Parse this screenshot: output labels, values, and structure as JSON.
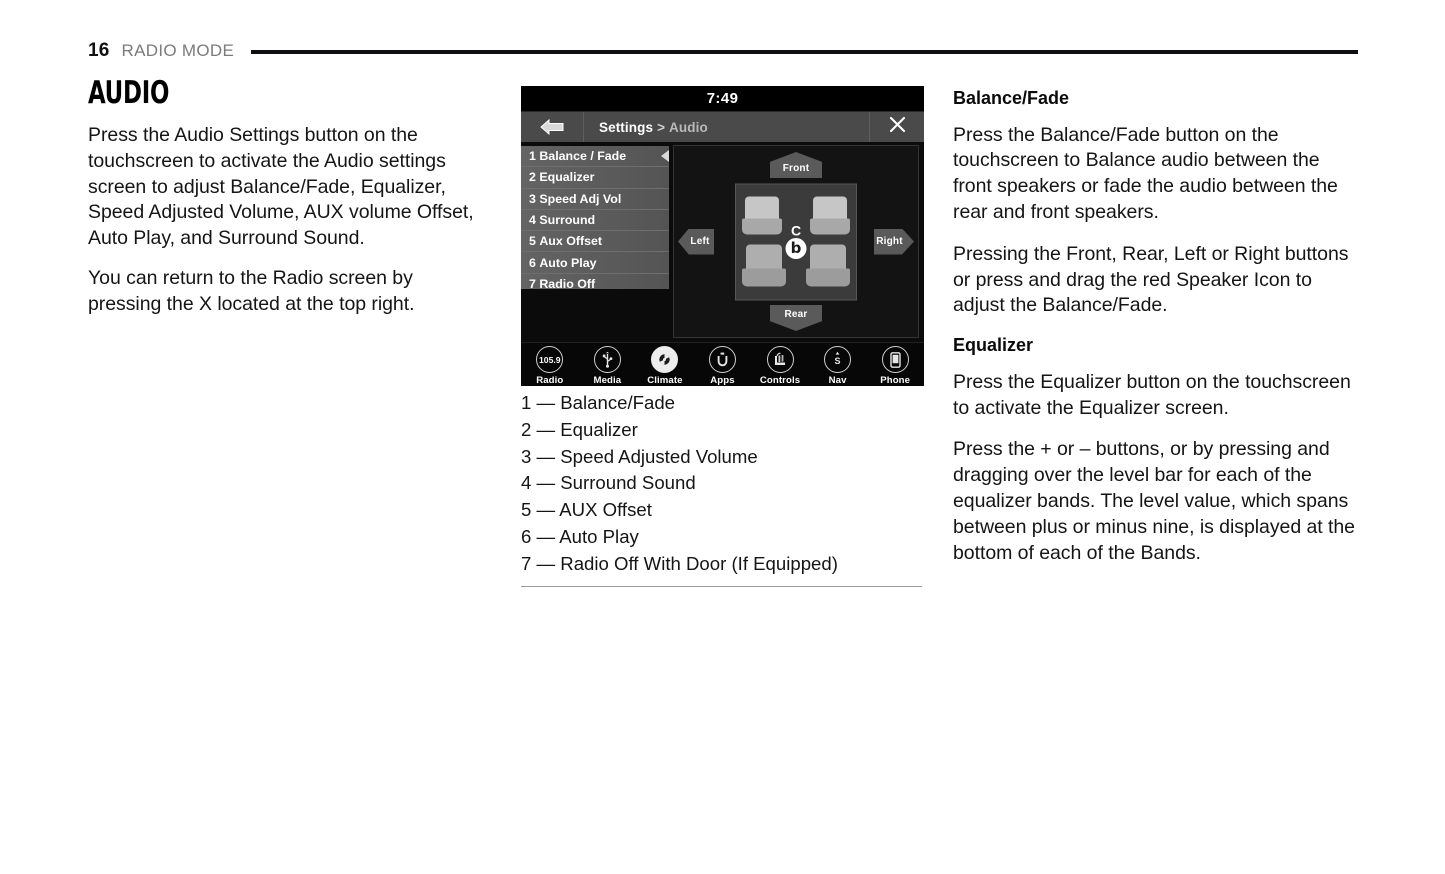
{
  "header": {
    "page_number": "16",
    "section": "RADIO MODE"
  },
  "left_column": {
    "title": "AUDIO",
    "paragraphs": [
      "Press the Audio Settings button on the touchscreen to activate the Audio settings screen to adjust Balance/Fade, Equalizer, Speed Adjusted Volume, AUX volume Offset, Auto Play, and Surround Sound.",
      "You can return to the Radio screen by pressing the X located at the top right."
    ]
  },
  "touchscreen": {
    "time": "7:49",
    "back_icon": "back-arrow-icon",
    "breadcrumb": {
      "root": "Settings",
      "separator": ">",
      "current": "Audio"
    },
    "close_icon": "✕",
    "menu": [
      {
        "num": "1",
        "label": "Balance / Fade",
        "selected": true
      },
      {
        "num": "2",
        "label": "Equalizer",
        "selected": false
      },
      {
        "num": "3",
        "label": "Speed Adj Vol",
        "selected": false
      },
      {
        "num": "4",
        "label": "Surround",
        "selected": false
      },
      {
        "num": "5",
        "label": "Aux Offset",
        "selected": false
      },
      {
        "num": "6",
        "label": "Auto Play",
        "selected": false
      },
      {
        "num": "7",
        "label": "Radio Off",
        "selected": false
      }
    ],
    "direction_buttons": {
      "front": "Front",
      "rear": "Rear",
      "left": "Left",
      "right": "Right"
    },
    "speaker_marker": {
      "glyph": "b",
      "crosshair": "C"
    },
    "nav": [
      {
        "label": "Radio",
        "icon": "radio-frequency-icon",
        "value": "105.9"
      },
      {
        "label": "Media",
        "icon": "usb-icon",
        "value": ""
      },
      {
        "label": "Climate",
        "icon": "climate-fan-icon",
        "value": ""
      },
      {
        "label": "Apps",
        "icon": "uconnect-apps-icon",
        "value": "u"
      },
      {
        "label": "Controls",
        "icon": "seat-controls-icon",
        "value": ""
      },
      {
        "label": "Nav",
        "icon": "compass-icon",
        "value": "S"
      },
      {
        "label": "Phone",
        "icon": "phone-icon",
        "value": ""
      }
    ]
  },
  "caption_list": [
    "1 — Balance/Fade",
    "2 — Equalizer",
    "3 — Speed Adjusted Volume",
    "4 — Surround Sound",
    "5 — AUX Offset",
    "6 — Auto Play",
    "7 — Radio Off With Door (If Equipped)"
  ],
  "right_column": {
    "sections": [
      {
        "heading": "Balance/Fade",
        "paragraphs": [
          "Press the Balance/Fade button on the touchscreen to Balance audio between the front speakers or fade the audio between the rear and front speakers.",
          "Pressing the Front, Rear, Left or Right buttons or press and drag the red Speaker Icon to adjust the Balance/Fade."
        ]
      },
      {
        "heading": "Equalizer",
        "paragraphs": [
          "Press the Equalizer button on the touchscreen to activate the Equalizer screen.",
          "Press the + or – buttons, or by pressing and dragging over the level bar for each of the equalizer bands. The level value, which spans between plus or minus nine, is displayed at the bottom of each of the Bands."
        ]
      }
    ]
  }
}
